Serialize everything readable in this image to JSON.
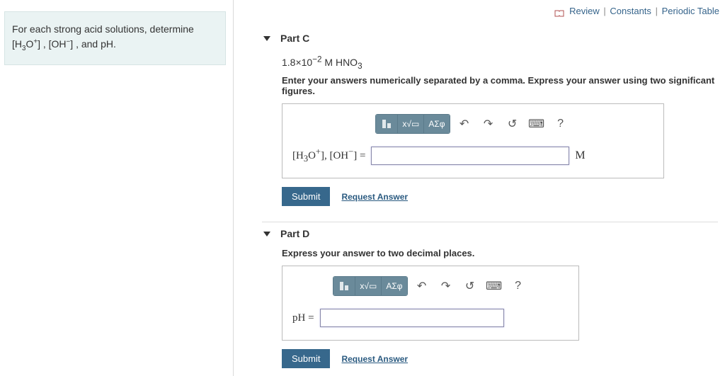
{
  "prompt": {
    "line1": "For each strong acid solutions, determine",
    "h3o": "H",
    "h3o_sub": "3",
    "h3o_rest": "O",
    "h3o_sup": "+",
    "oh": "OH",
    "oh_sup": "−",
    "tail": ", and pH."
  },
  "toplinks": {
    "review": "Review",
    "constants": "Constants",
    "periodic": "Periodic Table"
  },
  "partC": {
    "title": "Part C",
    "conc_prefix": "1.8×10",
    "conc_exp": "−2",
    "conc_unit": " M HNO",
    "conc_sub": "3",
    "instruction": "Enter your answers numerically separated by a comma. Express your answer using two significant figures.",
    "label_full": "[H3O+], [OH−] =",
    "unit": "M",
    "submit": "Submit",
    "request": "Request Answer",
    "toolbar": {
      "sqrt": "x√▭",
      "greek": "ΑΣφ",
      "undo": "↶",
      "redo": "↷",
      "reset": "↺",
      "keyboard": "⌨",
      "help": "?"
    }
  },
  "partD": {
    "title": "Part D",
    "instruction": "Express your answer to two decimal places.",
    "label": "pH =",
    "submit": "Submit",
    "request": "Request Answer",
    "toolbar": {
      "sqrt": "x√▭",
      "greek": "ΑΣφ",
      "undo": "↶",
      "redo": "↷",
      "reset": "↺",
      "keyboard": "⌨",
      "help": "?"
    }
  }
}
